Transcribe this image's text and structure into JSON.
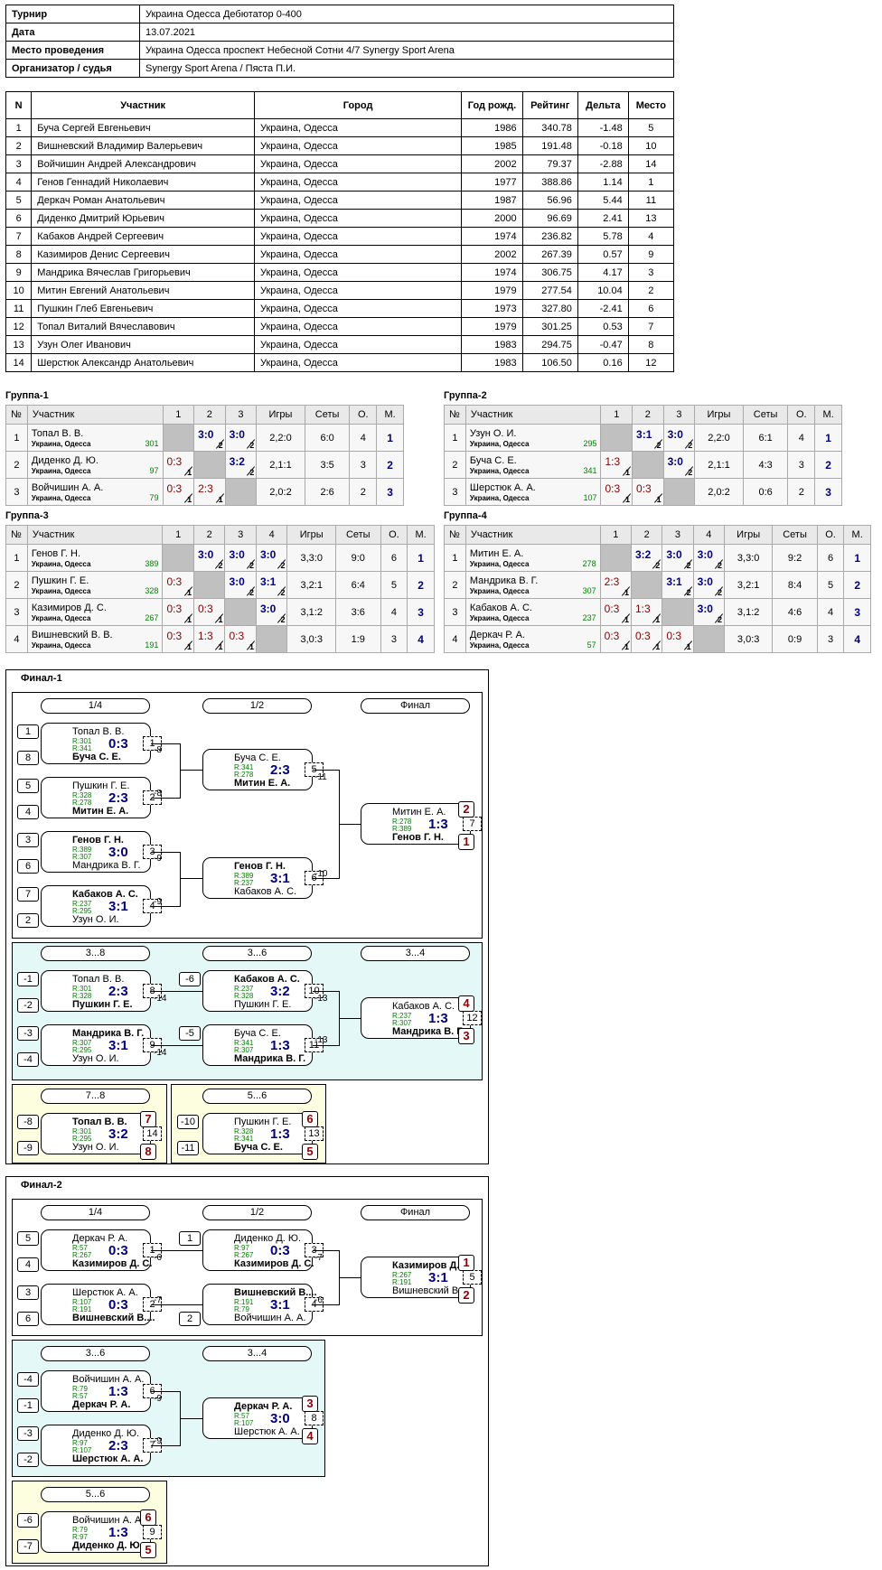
{
  "info": [
    [
      "Турнир",
      "Украина Одесса Дебютатор 0-400"
    ],
    [
      "Дата",
      "13.07.2021"
    ],
    [
      "Место проведения",
      "Украина Одесса проспект Небесной Сотни 4/7 Synergy Sport Arena"
    ],
    [
      "Организатор / судья",
      "Synergy Sport Arena / Пяста П.И."
    ]
  ],
  "plist_headers": [
    "N",
    "Участник",
    "Город",
    "Год рожд.",
    "Рейтинг",
    "Дельта",
    "Место"
  ],
  "players": [
    [
      "1",
      "Буча Сергей Евгеньевич",
      "Украина, Одесса",
      "1986",
      "340.78",
      "-1.48",
      "5"
    ],
    [
      "2",
      "Вишневский Владимир Валерьевич",
      "Украина, Одесса",
      "1985",
      "191.48",
      "-0.18",
      "10"
    ],
    [
      "3",
      "Войчишин Андрей Александрович",
      "Украина, Одесса",
      "2002",
      "79.37",
      "-2.88",
      "14"
    ],
    [
      "4",
      "Генов Геннадий Николаевич",
      "Украина, Одесса",
      "1977",
      "388.86",
      "1.14",
      "1"
    ],
    [
      "5",
      "Деркач Роман Анатольевич",
      "Украина, Одесса",
      "1987",
      "56.96",
      "5.44",
      "11"
    ],
    [
      "6",
      "Диденко Дмитрий Юрьевич",
      "Украина, Одесса",
      "2000",
      "96.69",
      "2.41",
      "13"
    ],
    [
      "7",
      "Кабаков Андрей Сергеевич",
      "Украина, Одесса",
      "1974",
      "236.82",
      "5.78",
      "4"
    ],
    [
      "8",
      "Казимиров Денис Сергеевич",
      "Украина, Одесса",
      "2002",
      "267.39",
      "0.57",
      "9"
    ],
    [
      "9",
      "Мандрика Вячеслав Григорьевич",
      "Украина, Одесса",
      "1974",
      "306.75",
      "4.17",
      "3"
    ],
    [
      "10",
      "Митин Евгений Анатольевич",
      "Украина, Одесса",
      "1979",
      "277.54",
      "10.04",
      "2"
    ],
    [
      "11",
      "Пушкин Глеб Евгеньевич",
      "Украина, Одесса",
      "1973",
      "327.80",
      "-2.41",
      "6"
    ],
    [
      "12",
      "Топал Виталий Вячеславович",
      "Украина, Одесса",
      "1979",
      "301.25",
      "0.53",
      "7"
    ],
    [
      "13",
      "Узун Олег Иванович",
      "Украина, Одесса",
      "1983",
      "294.75",
      "-0.47",
      "8"
    ],
    [
      "14",
      "Шерстюк Александр Анатольевич",
      "Украина, Одесса",
      "1983",
      "106.50",
      "0.16",
      "12"
    ]
  ],
  "group_headers": {
    "no": "№",
    "player": "Участник",
    "games": "Игры",
    "sets": "Сеты",
    "pts": "О.",
    "place": "М."
  },
  "groups": [
    {
      "title": "Группа-1",
      "rows": [
        {
          "n": "1",
          "name": "Топал В. В.",
          "city": "Украина, Одесса",
          "r": "301",
          "cells": [
            null,
            [
              "3:0",
              "2",
              "w"
            ],
            [
              "3:0",
              "2",
              "w"
            ]
          ],
          "g": "2,2:0",
          "s": "6:0",
          "o": "4",
          "m": "1"
        },
        {
          "n": "2",
          "name": "Диденко Д. Ю.",
          "city": "Украина, Одесса",
          "r": "97",
          "cells": [
            [
              "0:3",
              "1",
              "l"
            ],
            null,
            [
              "3:2",
              "2",
              "w"
            ]
          ],
          "g": "2,1:1",
          "s": "3:5",
          "o": "3",
          "m": "2"
        },
        {
          "n": "3",
          "name": "Войчишин А. А.",
          "city": "Украина, Одесса",
          "r": "79",
          "cells": [
            [
              "0:3",
              "1",
              "l"
            ],
            [
              "2:3",
              "1",
              "l"
            ],
            null
          ],
          "g": "2,0:2",
          "s": "2:6",
          "o": "2",
          "m": "3"
        }
      ]
    },
    {
      "title": "Группа-2",
      "rows": [
        {
          "n": "1",
          "name": "Узун О. И.",
          "city": "Украина, Одесса",
          "r": "295",
          "cells": [
            null,
            [
              "3:1",
              "2",
              "w"
            ],
            [
              "3:0",
              "2",
              "w"
            ]
          ],
          "g": "2,2:0",
          "s": "6:1",
          "o": "4",
          "m": "1"
        },
        {
          "n": "2",
          "name": "Буча С. Е.",
          "city": "Украина, Одесса",
          "r": "341",
          "cells": [
            [
              "1:3",
              "1",
              "l"
            ],
            null,
            [
              "3:0",
              "2",
              "w"
            ]
          ],
          "g": "2,1:1",
          "s": "4:3",
          "o": "3",
          "m": "2"
        },
        {
          "n": "3",
          "name": "Шерстюк А. А.",
          "city": "Украина, Одесса",
          "r": "107",
          "cells": [
            [
              "0:3",
              "1",
              "l"
            ],
            [
              "0:3",
              "1",
              "l"
            ],
            null
          ],
          "g": "2,0:2",
          "s": "0:6",
          "o": "2",
          "m": "3"
        }
      ]
    },
    {
      "title": "Группа-3",
      "rows": [
        {
          "n": "1",
          "name": "Генов Г. Н.",
          "city": "Украина, Одесса",
          "r": "389",
          "cells": [
            null,
            [
              "3:0",
              "2",
              "w"
            ],
            [
              "3:0",
              "2",
              "w"
            ],
            [
              "3:0",
              "2",
              "w"
            ]
          ],
          "g": "3,3:0",
          "s": "9:0",
          "o": "6",
          "m": "1"
        },
        {
          "n": "2",
          "name": "Пушкин Г. Е.",
          "city": "Украина, Одесса",
          "r": "328",
          "cells": [
            [
              "0:3",
              "1",
              "l"
            ],
            null,
            [
              "3:0",
              "2",
              "w"
            ],
            [
              "3:1",
              "2",
              "w"
            ]
          ],
          "g": "3,2:1",
          "s": "6:4",
          "o": "5",
          "m": "2"
        },
        {
          "n": "3",
          "name": "Казимиров Д. С.",
          "city": "Украина, Одесса",
          "r": "267",
          "cells": [
            [
              "0:3",
              "1",
              "l"
            ],
            [
              "0:3",
              "1",
              "l"
            ],
            null,
            [
              "3:0",
              "2",
              "w"
            ]
          ],
          "g": "3,1:2",
          "s": "3:6",
          "o": "4",
          "m": "3"
        },
        {
          "n": "4",
          "name": "Вишневский В. В.",
          "city": "Украина, Одесса",
          "r": "191",
          "cells": [
            [
              "0:3",
              "1",
              "l"
            ],
            [
              "1:3",
              "1",
              "l"
            ],
            [
              "0:3",
              "1",
              "l"
            ],
            null
          ],
          "g": "3,0:3",
          "s": "1:9",
          "o": "3",
          "m": "4"
        }
      ]
    },
    {
      "title": "Группа-4",
      "rows": [
        {
          "n": "1",
          "name": "Митин Е. А.",
          "city": "Украина, Одесса",
          "r": "278",
          "cells": [
            null,
            [
              "3:2",
              "2",
              "w"
            ],
            [
              "3:0",
              "2",
              "w"
            ],
            [
              "3:0",
              "2",
              "w"
            ]
          ],
          "g": "3,3:0",
          "s": "9:2",
          "o": "6",
          "m": "1"
        },
        {
          "n": "2",
          "name": "Мандрика В. Г.",
          "city": "Украина, Одесса",
          "r": "307",
          "cells": [
            [
              "2:3",
              "1",
              "l"
            ],
            null,
            [
              "3:1",
              "2",
              "w"
            ],
            [
              "3:0",
              "2",
              "w"
            ]
          ],
          "g": "3,2:1",
          "s": "8:4",
          "o": "5",
          "m": "2"
        },
        {
          "n": "3",
          "name": "Кабаков А. С.",
          "city": "Украина, Одесса",
          "r": "237",
          "cells": [
            [
              "0:3",
              "1",
              "l"
            ],
            [
              "1:3",
              "1",
              "l"
            ],
            null,
            [
              "3:0",
              "2",
              "w"
            ]
          ],
          "g": "3,1:2",
          "s": "4:6",
          "o": "4",
          "m": "3"
        },
        {
          "n": "4",
          "name": "Деркач Р. А.",
          "city": "Украина, Одесса",
          "r": "57",
          "cells": [
            [
              "0:3",
              "1",
              "l"
            ],
            [
              "0:3",
              "1",
              "l"
            ],
            [
              "0:3",
              "1",
              "l"
            ],
            null
          ],
          "g": "3,0:3",
          "s": "0:9",
          "o": "3",
          "m": "4"
        }
      ]
    }
  ],
  "finals": {
    "f1_title": "Финал-1",
    "f2_title": "Финал-2",
    "pills": {
      "q": "1/4",
      "s": "1/2",
      "f": "Финал",
      "p38": "3...8",
      "p36": "3...6",
      "p34": "3...4",
      "p78": "7...8",
      "p56": "5...6"
    },
    "matches": [
      {
        "a": "Топал В. В.",
        "ra": "R:301",
        "rb": "R:341",
        "b": "Буча С. Е.",
        "w": "b",
        "sc": "0:3",
        "mn": "1"
      },
      {
        "a": "Пушкин Г. Е.",
        "ra": "R:328",
        "rb": "R:278",
        "b": "Митин Е. А.",
        "w": "b",
        "sc": "2:3",
        "mn": "2"
      },
      {
        "a": "Генов Г. Н.",
        "ra": "R:389",
        "rb": "R:307",
        "b": "Мандрика В. Г.",
        "w": "a",
        "sc": "3:0",
        "mn": "3"
      },
      {
        "a": "Кабаков А. С.",
        "ra": "R:237",
        "rb": "R:295",
        "b": "Узун О. И.",
        "w": "a",
        "sc": "3:1",
        "mn": "4"
      },
      {
        "a": "Буча С. Е.",
        "ra": "R:341",
        "rb": "R:278",
        "b": "Митин Е. А.",
        "w": "b",
        "sc": "2:3",
        "mn": "5"
      },
      {
        "a": "Генов Г. Н.",
        "ra": "R:389",
        "rb": "R:237",
        "b": "Кабаков А. С.",
        "w": "a",
        "sc": "3:1",
        "mn": "6"
      },
      {
        "a": "Митин Е. А.",
        "ra": "R:278",
        "rb": "R:389",
        "b": "Генов Г. Н.",
        "w": "b",
        "sc": "1:3",
        "mn": "7"
      },
      {
        "a": "Топал В. В.",
        "ra": "R:301",
        "rb": "R:328",
        "b": "Пушкин Г. Е.",
        "w": "b",
        "sc": "2:3",
        "mn": "8"
      },
      {
        "a": "Мандрика В. Г.",
        "ra": "R:307",
        "rb": "R:295",
        "b": "Узун О. И.",
        "w": "a",
        "sc": "3:1",
        "mn": "9"
      },
      {
        "a": "Кабаков А. С.",
        "ra": "R:237",
        "rb": "R:328",
        "b": "Пушкин Г. Е.",
        "w": "a",
        "sc": "3:2",
        "mn": "10"
      },
      {
        "a": "Буча С. Е.",
        "ra": "R:341",
        "rb": "R:307",
        "b": "Мандрика В. Г.",
        "w": "b",
        "sc": "1:3",
        "mn": "11"
      },
      {
        "a": "Кабаков А. С.",
        "ra": "R:237",
        "rb": "R:307",
        "b": "Мандрика В. Г.",
        "w": "b",
        "sc": "1:3",
        "mn": "12"
      },
      {
        "a": "Топал В. В.",
        "ra": "R:301",
        "rb": "R:295",
        "b": "Узун О. И.",
        "w": "a",
        "sc": "3:2",
        "mn": "14"
      },
      {
        "a": "Пушкин Г. Е.",
        "ra": "R:328",
        "rb": "R:341",
        "b": "Буча С. Е.",
        "w": "b",
        "sc": "1:3",
        "mn": "13"
      },
      {
        "a": "Деркач Р. А.",
        "ra": "R:57",
        "rb": "R:267",
        "b": "Казимиров Д. С.",
        "w": "b",
        "sc": "0:3",
        "mn": "1"
      },
      {
        "a": "Шерстюк А. А.",
        "ra": "R:107",
        "rb": "R:191",
        "b": "Вишневский В....",
        "w": "b",
        "sc": "0:3",
        "mn": "2"
      },
      {
        "a": "Диденко Д. Ю.",
        "ra": "R:97",
        "rb": "R:267",
        "b": "Казимиров Д. С.",
        "w": "b",
        "sc": "0:3",
        "mn": "3"
      },
      {
        "a": "Вишневский В....",
        "ra": "R:191",
        "rb": "R:79",
        "b": "Войчишин А. А.",
        "w": "a",
        "sc": "3:1",
        "mn": "4"
      },
      {
        "a": "Казимиров Д. С.",
        "ra": "R:267",
        "rb": "R:191",
        "b": "Вишневский В....",
        "w": "a",
        "sc": "3:1",
        "mn": "5"
      },
      {
        "a": "Войчишин А. А.",
        "ra": "R:79",
        "rb": "R:57",
        "b": "Деркач Р. А.",
        "w": "b",
        "sc": "1:3",
        "mn": "6"
      },
      {
        "a": "Диденко Д. Ю.",
        "ra": "R:97",
        "rb": "R:107",
        "b": "Шерстюк А. А.",
        "w": "b",
        "sc": "2:3",
        "mn": "7"
      },
      {
        "a": "Деркач Р. А.",
        "ra": "R:57",
        "rb": "R:107",
        "b": "Шерстюк А. А.",
        "w": "a",
        "sc": "3:0",
        "mn": "8"
      },
      {
        "a": "Войчишин А. А.",
        "ra": "R:79",
        "rb": "R:97",
        "b": "Диденко Д. Ю.",
        "w": "b",
        "sc": "1:3",
        "mn": "9"
      }
    ],
    "seeds": [
      "1",
      "8",
      "5",
      "4",
      "3",
      "6",
      "7",
      "2",
      "-1",
      "-2",
      "-3",
      "-4",
      "-6",
      "-5",
      "-8",
      "-9",
      "-10",
      "-11",
      "5",
      "4",
      "3",
      "6",
      "1",
      "2",
      "-4",
      "-1",
      "-3",
      "-2",
      "-6",
      "-7"
    ],
    "labels": [
      "-8",
      "-8",
      "-9",
      "-9",
      "-11",
      "-10",
      "-14",
      "-14",
      "-13",
      "-13",
      "-6",
      "-7",
      "-7",
      "-6",
      "-9",
      "-9"
    ],
    "places": [
      "2",
      "1",
      "4",
      "3",
      "7",
      "8",
      "6",
      "5",
      "1",
      "2",
      "3",
      "4",
      "6",
      "5"
    ]
  }
}
